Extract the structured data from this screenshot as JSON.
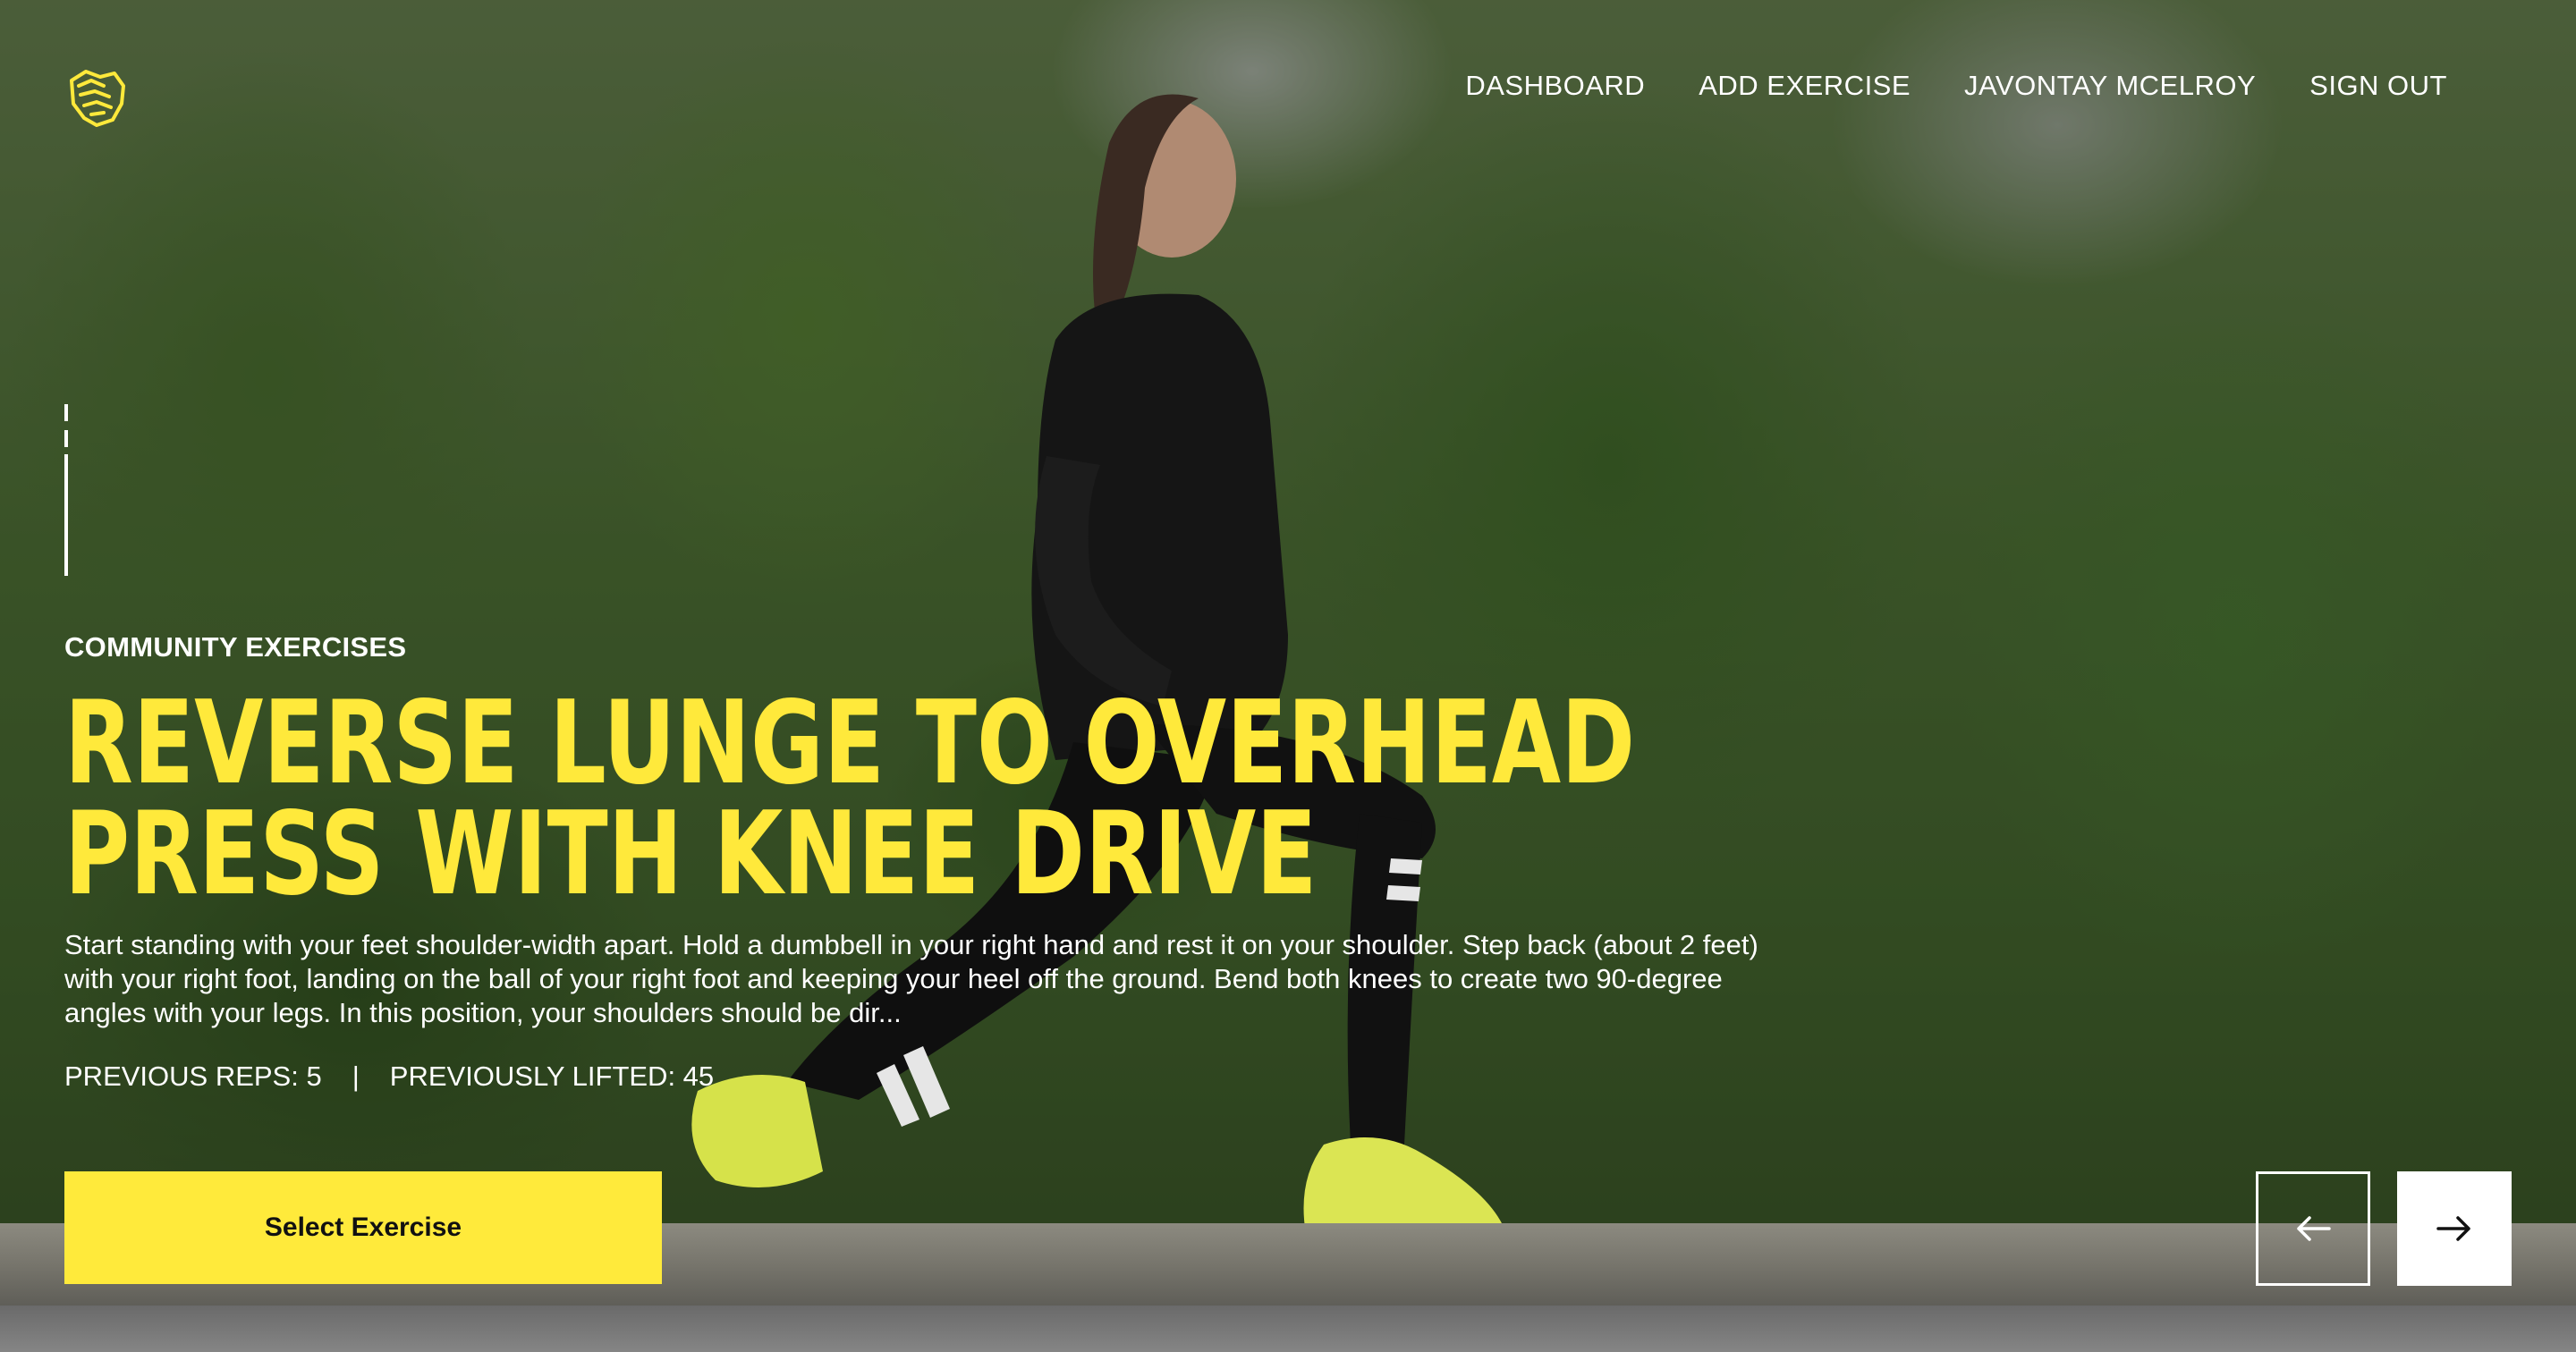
{
  "nav": {
    "items": [
      {
        "label": "DASHBOARD"
      },
      {
        "label": "ADD EXERCISE"
      },
      {
        "label": "JAVONTAY MCELROY"
      },
      {
        "label": "SIGN OUT"
      }
    ],
    "logo_icon": "lion-head-icon"
  },
  "hero": {
    "eyebrow": "COMMUNITY EXERCISES",
    "title": "REVERSE LUNGE TO OVERHEAD PRESS WITH KNEE DRIVE",
    "description": "Start standing with your feet shoulder-width apart. Hold a dumbbell in your right hand and rest it on your shoulder. Step back (about 2 feet) with your right foot, landing on the ball of your right foot and keeping your heel off the ground. Bend both knees to create two 90-degree angles with your legs. In this position, your shoulders should be dir...",
    "stats": {
      "reps": "PREVIOUS REPS: 5",
      "separator": "|",
      "lifted": "PREVIOUSLY LIFTED: 45"
    },
    "select_label": "Select Exercise"
  },
  "carousel": {
    "prev_icon": "arrow-left-icon",
    "next_icon": "arrow-right-icon"
  },
  "colors": {
    "accent": "#ffe93b",
    "text": "#ffffff"
  }
}
